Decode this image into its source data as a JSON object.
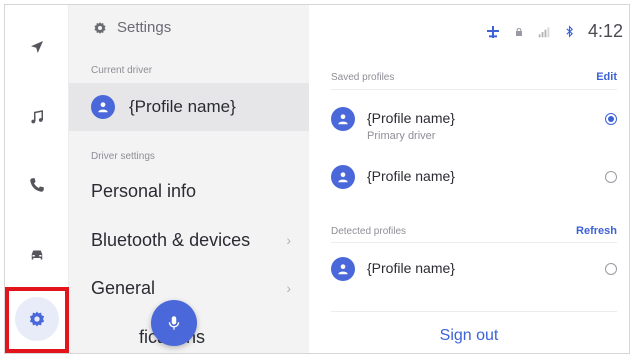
{
  "rail": {
    "items": [
      {
        "icon": "navigation-icon"
      },
      {
        "icon": "music-icon"
      },
      {
        "icon": "phone-icon"
      },
      {
        "icon": "car-icon"
      },
      {
        "icon": "gear-icon"
      }
    ],
    "highlight_color": "#e2141c"
  },
  "settings": {
    "title": "Settings",
    "current_driver_label": "Current driver",
    "current_driver_name": "{Profile name}",
    "driver_settings_label": "Driver settings",
    "menu": [
      {
        "label": "Personal info",
        "chevron": false
      },
      {
        "label": "Bluetooth & devices",
        "chevron": true
      },
      {
        "label": "General",
        "chevron": true
      },
      {
        "label": "fications",
        "chevron": false
      }
    ]
  },
  "status": {
    "time": "4:12",
    "icons": [
      "wifi-icon",
      "lock-icon",
      "signal-icon",
      "bluetooth-icon"
    ]
  },
  "saved_profiles": {
    "label": "Saved profiles",
    "action": "Edit",
    "items": [
      {
        "name": "{Profile name}",
        "sub": "Primary driver",
        "selected": true
      },
      {
        "name": "{Profile name}",
        "sub": "",
        "selected": false
      }
    ]
  },
  "detected_profiles": {
    "label": "Detected profiles",
    "action": "Refresh",
    "items": [
      {
        "name": "{Profile name}",
        "selected": false
      }
    ]
  },
  "sign_out": "Sign out",
  "colors": {
    "accent": "#3c62d8",
    "avatar": "#4a68d9",
    "panel_bg": "#f3f3f4"
  }
}
